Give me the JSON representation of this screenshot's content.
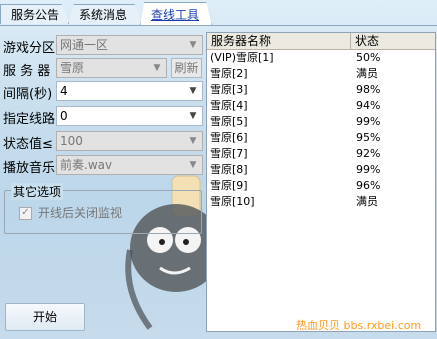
{
  "tabs": [
    {
      "label": "服务公告"
    },
    {
      "label": "系统消息"
    },
    {
      "label": "查线工具"
    }
  ],
  "form": {
    "zone_label": "游戏分区",
    "zone_value": "网通一区",
    "server_label": "服 务 器",
    "server_value": "雪原",
    "refresh_label": "刷新",
    "interval_label": "间隔(秒)",
    "interval_value": "4",
    "line_label": "指定线路",
    "line_value": "0",
    "status_label": "状态值≤",
    "status_value": "100",
    "music_label": "播放音乐",
    "music_value": "前奏.wav"
  },
  "options": {
    "title": "其它选项",
    "checkbox_label": "开线后关闭监视",
    "checked": true
  },
  "start_label": "开始",
  "table": {
    "headers": [
      "服务器名称",
      "状态"
    ],
    "rows": [
      [
        "(VIP)雪原[1]",
        "50%"
      ],
      [
        "雪原[2]",
        "满员"
      ],
      [
        "雪原[3]",
        "98%"
      ],
      [
        "雪原[4]",
        "94%"
      ],
      [
        "雪原[5]",
        "99%"
      ],
      [
        "雪原[6]",
        "95%"
      ],
      [
        "雪原[7]",
        "92%"
      ],
      [
        "雪原[8]",
        "99%"
      ],
      [
        "雪原[9]",
        "96%"
      ],
      [
        "雪原[10]",
        "满员"
      ]
    ]
  },
  "watermark": "热血贝贝 bbs.rxbei.com",
  "colors": {
    "active_tab": "#1a3fb0",
    "watermark": "#ff9a1a"
  }
}
